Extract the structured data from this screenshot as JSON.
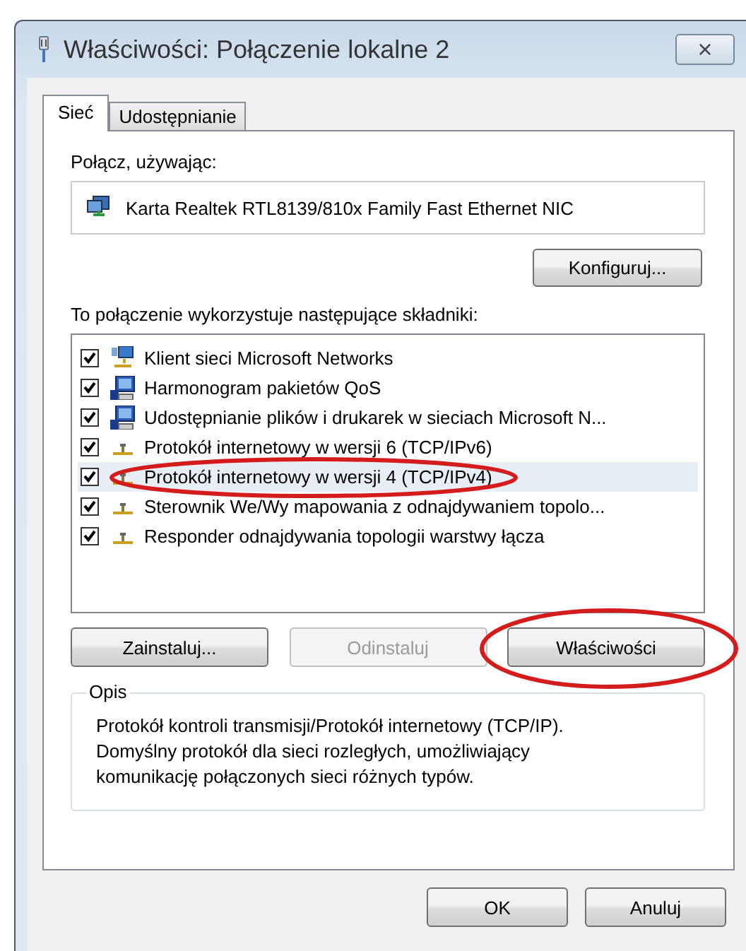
{
  "window": {
    "title": "Właściwości: Połączenie lokalne 2",
    "close": "×"
  },
  "tabs": [
    {
      "label": "Sieć",
      "selected": true
    },
    {
      "label": "Udostępnianie",
      "selected": false
    }
  ],
  "connect_using": {
    "label": "Połącz, używając:",
    "adapter": "Karta Realtek RTL8139/810x Family Fast Ethernet NIC",
    "button": "Konfiguruj..."
  },
  "components": {
    "label": "To połączenie wykorzystuje następujące składniki:",
    "items": [
      {
        "kind": "client",
        "label": "Klient sieci Microsoft Networks",
        "checked": true,
        "selected": false
      },
      {
        "kind": "service",
        "label": "Harmonogram pakietów QoS",
        "checked": true,
        "selected": false
      },
      {
        "kind": "service",
        "label": "Udostępnianie plików i drukarek w sieciach Microsoft N...",
        "checked": true,
        "selected": false
      },
      {
        "kind": "protocol",
        "label": "Protokół internetowy w wersji 6 (TCP/IPv6)",
        "checked": true,
        "selected": false
      },
      {
        "kind": "protocol",
        "label": "Protokół internetowy w wersji 4 (TCP/IPv4)",
        "checked": true,
        "selected": true
      },
      {
        "kind": "protocol",
        "label": "Sterownik We/Wy mapowania z odnajdywaniem topolo...",
        "checked": true,
        "selected": false
      },
      {
        "kind": "protocol",
        "label": "Responder odnajdywania topologii warstwy łącza",
        "checked": true,
        "selected": false
      }
    ]
  },
  "actions": [
    {
      "label": "Zainstaluj...",
      "disabled": false
    },
    {
      "label": "Odinstaluj",
      "disabled": true
    },
    {
      "label": "Właściwości",
      "disabled": false
    }
  ],
  "description": {
    "title": "Opis",
    "text": "Protokół kontroli transmisji/Protokół internetowy (TCP/IP). Domyślny protokół dla sieci rozległych, umożliwiający komunikację połączonych sieci różnych typów."
  },
  "footer_buttons": [
    "OK",
    "Anuluj"
  ],
  "annotations": [
    {
      "kind": "ellipse"
    },
    {
      "kind": "ellipse"
    }
  ]
}
